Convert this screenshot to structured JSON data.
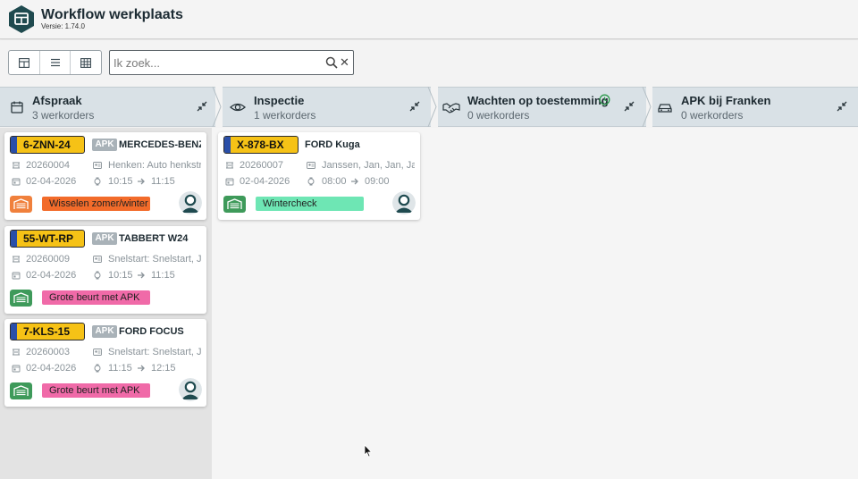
{
  "app": {
    "title": "Workflow werkplaats",
    "version": "Versie: 1.74.0"
  },
  "search": {
    "placeholder": "Ik zoek...",
    "value": ""
  },
  "columns": [
    {
      "title": "Afspraak",
      "count": "3 werkorders"
    },
    {
      "title": "Inspectie",
      "count": "1 werkorders"
    },
    {
      "title": "Wachten op toestemming",
      "count": "0 werkorders"
    },
    {
      "title": "APK bij Franken",
      "count": "0 werkorders"
    }
  ],
  "cards": [
    {
      "plate": "6-ZNN-24",
      "apk": "APK",
      "model": "MERCEDES-BENZ ACTROS",
      "order": "20260004",
      "customer": "Henken: Auto henkstraat",
      "date": "02-04-2026",
      "start": "10:15",
      "end": "11:15",
      "tag": "Wisselen zomer/winter",
      "tag_color": "#f26b2a",
      "garage_color": "#f0803c",
      "avatar": true
    },
    {
      "plate": "55-WT-RP",
      "apk": "APK",
      "model": "TABBERT W24",
      "order": "20260009",
      "customer": "Snelstart: Snelstart, Jan",
      "date": "02-04-2026",
      "start": "10:15",
      "end": "11:15",
      "tag": "Grote beurt met APK",
      "tag_color": "#f06aa8",
      "garage_color": "#3e9a5a",
      "avatar": false
    },
    {
      "plate": "7-KLS-15",
      "apk": "APK",
      "model": "FORD FOCUS",
      "order": "20260003",
      "customer": "Snelstart: Snelstart, Jan",
      "date": "02-04-2026",
      "start": "11:15",
      "end": "12:15",
      "tag": "Grote beurt met APK",
      "tag_color": "#f06aa8",
      "garage_color": "#3e9a5a",
      "avatar": true
    },
    {
      "plate": "X-878-BX",
      "apk": "",
      "model": "FORD Kuga",
      "order": "20260007",
      "customer": "Janssen, Jan, Jan, Jan",
      "date": "02-04-2026",
      "start": "08:00",
      "end": "09:00",
      "tag": "Wintercheck",
      "tag_color": "#6ee6b4",
      "garage_color": "#3e9a5a",
      "avatar": true
    }
  ],
  "colors": {
    "header_bg": "#d9e1e6",
    "plate": "#f6c216",
    "brand": "#1f4a4f"
  }
}
